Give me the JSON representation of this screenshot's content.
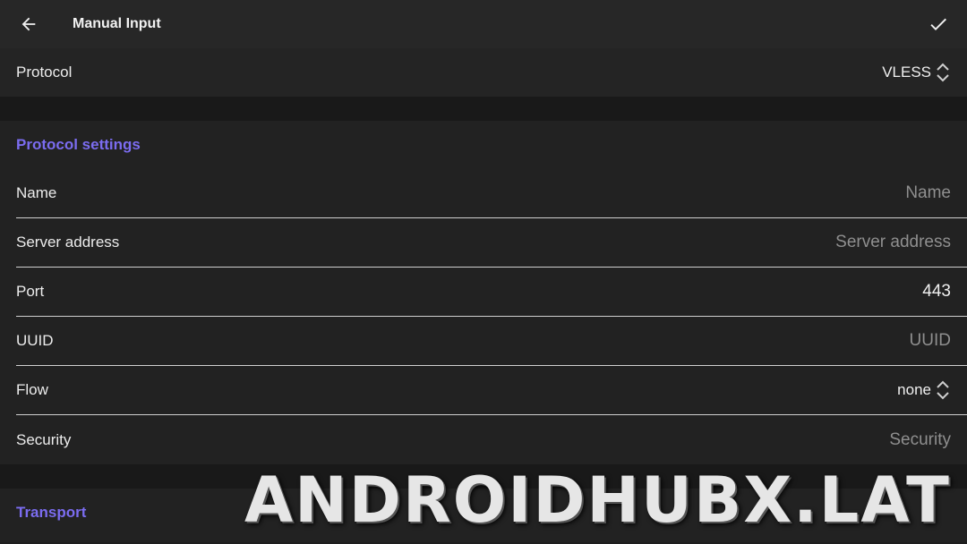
{
  "appbar": {
    "title": "Manual Input",
    "back_icon": "arrow-left-icon",
    "confirm_icon": "check-icon"
  },
  "protocol": {
    "label": "Protocol",
    "value": "VLESS"
  },
  "protocol_settings": {
    "header": "Protocol settings",
    "fields": [
      {
        "label": "Name",
        "placeholder": "Name",
        "value": ""
      },
      {
        "label": "Server address",
        "placeholder": "Server address",
        "value": ""
      },
      {
        "label": "Port",
        "placeholder": "",
        "value": "443"
      },
      {
        "label": "UUID",
        "placeholder": "UUID",
        "value": ""
      },
      {
        "label": "Flow",
        "value": "none"
      },
      {
        "label": "Security",
        "placeholder": "Security",
        "value": ""
      }
    ]
  },
  "transport": {
    "header": "Transport"
  },
  "watermark": "ANDROIDHUBX.LAT",
  "colors": {
    "accent": "#7b6cf0",
    "background": "#1e1e1e",
    "appbar": "#272727"
  }
}
